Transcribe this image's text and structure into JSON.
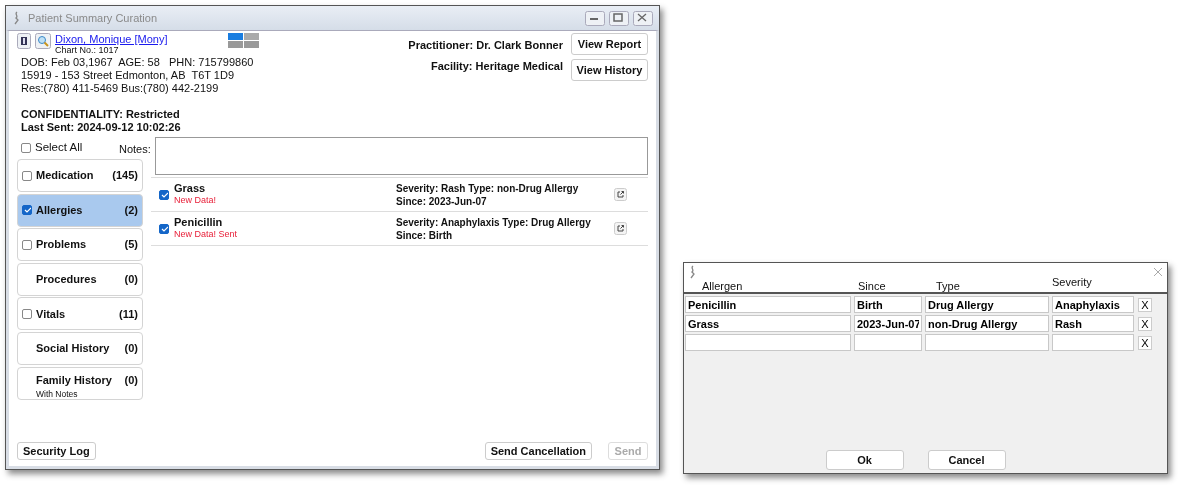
{
  "main_window": {
    "title": "Patient Summary Curation",
    "patient": {
      "name": "Dixon, Monique [Mony]",
      "chart_no": "Chart No.: 1017",
      "dob_line": "DOB: Feb 03,1967  AGE: 58   PHN: 715799860",
      "address": "15919 - 153 Street Edmonton, AB  T6T 1D9",
      "phones": "Res:(780) 411-5469 Bus:(780) 442-2199",
      "confidentiality": "CONFIDENTIALITY: Restricted",
      "last_sent": "Last Sent: 2024-09-12 10:02:26"
    },
    "practitioner": "Practitioner: Dr. Clark Bonner",
    "facility": "Facility: Heritage Medical",
    "header_buttons": [
      "View Report",
      "View History"
    ],
    "select_all": {
      "label": "Select All",
      "checked": false
    },
    "notes_label": "Notes:",
    "categories": [
      {
        "kind": "checkbox",
        "label": "Medication",
        "count": "(145)",
        "checked": false,
        "selected": false
      },
      {
        "kind": "checkbox",
        "label": "Allergies",
        "count": "(2)",
        "checked": true,
        "selected": true
      },
      {
        "kind": "checkbox",
        "label": "Problems",
        "count": "(5)",
        "checked": false,
        "selected": false
      },
      {
        "kind": "plain",
        "label": "Procedures",
        "count": "(0)",
        "selected": false
      },
      {
        "kind": "checkbox",
        "label": "Vitals",
        "count": "(11)",
        "checked": false,
        "selected": false
      },
      {
        "kind": "plain",
        "label": "Social History",
        "count": "(0)",
        "selected": false
      },
      {
        "kind": "plain",
        "label": "Family History",
        "count": "(0)",
        "note": "With Notes",
        "selected": false
      }
    ],
    "items": [
      {
        "name": "Grass",
        "status": "New Data!",
        "detail": "Severity: Rash Type: non-Drug Allergy",
        "since": "Since: 2023-Jun-07",
        "checked": true
      },
      {
        "name": "Penicillin",
        "status": "New Data! Sent",
        "detail": "Severity: Anaphylaxis Type: Drug Allergy",
        "since": "Since: Birth",
        "checked": true
      }
    ],
    "footer": {
      "left_button": {
        "label": "Security Log",
        "disabled": false
      },
      "right_buttons": [
        {
          "label": "Send Cancellation",
          "disabled": false
        },
        {
          "label": "Send",
          "disabled": true
        }
      ]
    }
  },
  "dialog": {
    "columns": [
      "Allergen",
      "Since",
      "Type",
      "Severity"
    ],
    "rows": [
      {
        "allergen": "Penicillin",
        "since": "Birth",
        "type": "Drug Allergy",
        "severity": "Anaphylaxis",
        "remove": "X"
      },
      {
        "allergen": "Grass",
        "since": "2023-Jun-07",
        "type": "non-Drug Allergy",
        "severity": "Rash",
        "remove": "X"
      }
    ],
    "new_row_remove": "X",
    "buttons": [
      "Ok",
      "Cancel"
    ]
  }
}
